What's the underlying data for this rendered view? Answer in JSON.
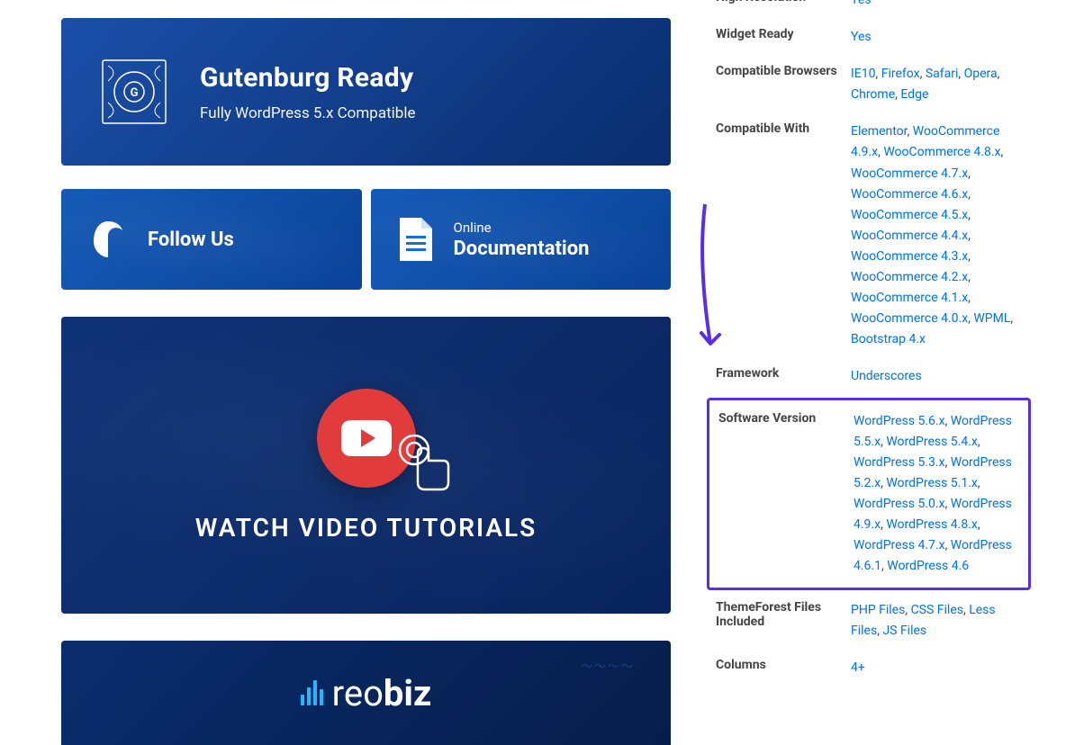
{
  "banners": {
    "gutenberg": {
      "title": "Gutenburg Ready",
      "subtitle": "Fully WordPress 5.x Compatible"
    },
    "follow": {
      "label": "Follow Us"
    },
    "docs": {
      "sub": "Online",
      "label": "Documentation"
    },
    "video": {
      "title": "WATCH VIDEO TUTORIALS"
    },
    "reobiz": {
      "name_light": "reo",
      "name_bold": "biz"
    }
  },
  "specs": {
    "rows": [
      {
        "label": "High Resolution",
        "values": [
          "Yes"
        ]
      },
      {
        "label": "Widget Ready",
        "values": [
          "Yes"
        ]
      },
      {
        "label": "Compatible Browsers",
        "values": [
          "IE10",
          "Firefox",
          "Safari",
          "Opera",
          "Chrome",
          "Edge"
        ]
      },
      {
        "label": "Compatible With",
        "values": [
          "Elementor",
          "WooCommerce 4.9.x",
          "WooCommerce 4.8.x",
          "WooCommerce 4.7.x",
          "WooCommerce 4.6.x",
          "WooCommerce 4.5.x",
          "WooCommerce 4.4.x",
          "WooCommerce 4.3.x",
          "WooCommerce 4.2.x",
          "WooCommerce 4.1.x",
          "WooCommerce 4.0.x",
          "WPML",
          "Bootstrap 4.x"
        ]
      },
      {
        "label": "Framework",
        "values": [
          "Underscores"
        ]
      },
      {
        "label": "Software Version",
        "highlight": true,
        "values": [
          "WordPress 5.6.x",
          "WordPress 5.5.x",
          "WordPress 5.4.x",
          "WordPress 5.3.x",
          "WordPress 5.2.x",
          "WordPress 5.1.x",
          "WordPress 5.0.x",
          "WordPress 4.9.x",
          "WordPress 4.8.x",
          "WordPress 4.7.x",
          "WordPress 4.6.1",
          "WordPress 4.6"
        ]
      },
      {
        "label": "ThemeForest Files Included",
        "values": [
          "PHP Files",
          "CSS Files",
          "Less Files",
          "JS Files"
        ]
      },
      {
        "label": "Columns",
        "values": [
          "4+"
        ]
      }
    ]
  }
}
